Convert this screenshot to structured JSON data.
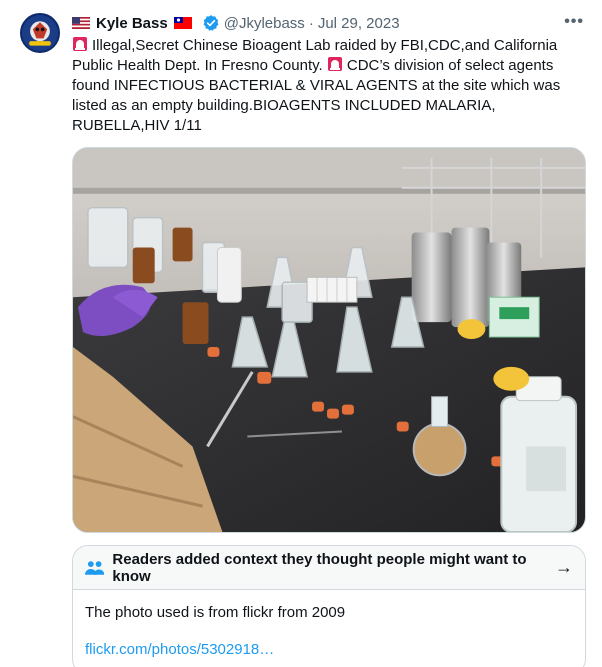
{
  "author": {
    "name": "Kyle Bass",
    "handle": "@Jkylebass",
    "separator": "·",
    "date": "Jul 29, 2023"
  },
  "tweet": {
    "text_part1": "Illegal,Secret Chinese Bioagent Lab raided by FBI,CDC,and California Public Health Dept. In Fresno County. ",
    "text_part2": "CDC’s division of select agents found INFECTIOUS BACTERIAL & VIRAL AGENTS at the site which was listed as an empty building.BIOAGENTS INCLUDED MALARIA, RUBELLA,HIV 1/11"
  },
  "media": {
    "icon": "lab-bench-photo"
  },
  "community_note": {
    "header": "Readers added context they thought people might want to know",
    "arrow": "→",
    "body": "The photo used is from flickr from 2009",
    "link": "flickr.com/photos/5302918…"
  },
  "icons": {
    "more": "•••",
    "verified_color": "#1d9bf0",
    "people_color": "#1d9bf0",
    "siren_color": "#e0245e"
  }
}
